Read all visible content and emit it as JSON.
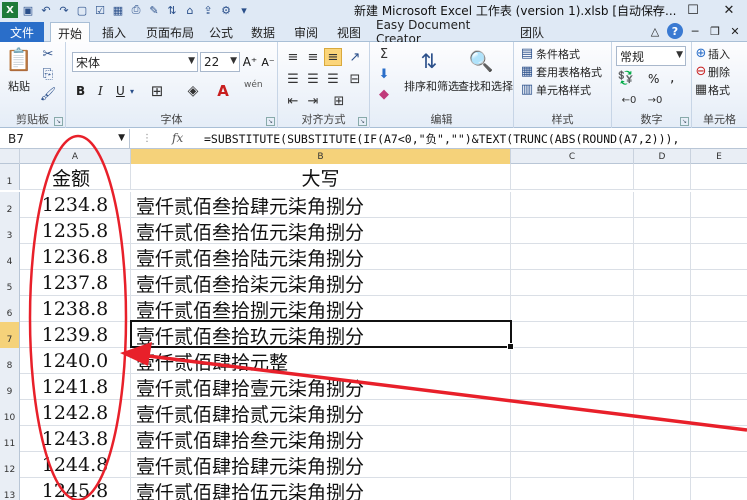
{
  "window": {
    "title": "新建 Microsoft Excel 工作表 (version 1).xlsb [自动保存...",
    "minimize": "─",
    "maximize": "☐",
    "close": "✕"
  },
  "tabs": {
    "file": "文件",
    "home": "开始",
    "insert": "插入",
    "page_layout": "页面布局",
    "formulas": "公式",
    "data": "数据",
    "review": "审阅",
    "view": "视图",
    "easy_doc": "Easy Document Creator",
    "team": "团队"
  },
  "ribbon": {
    "clipboard": {
      "paste": "粘贴",
      "label": "剪贴板"
    },
    "font": {
      "name": "宋体",
      "size": "22",
      "label": "字体",
      "bold": "B",
      "italic": "I",
      "underline": "U",
      "wen": "wén"
    },
    "alignment": {
      "label": "对齐方式"
    },
    "editing": {
      "sort_filter": "排序和筛选",
      "find_select": "查找和选择",
      "label": "编辑"
    },
    "styles": {
      "conditional": "条件格式",
      "table_format": "套用表格格式",
      "cell_styles": "单元格样式",
      "label": "样式"
    },
    "number": {
      "format": "常规",
      "percent": "%",
      "comma": ",",
      "label": "数字"
    },
    "cells": {
      "insert": "插入",
      "delete": "删除",
      "format": "格式",
      "label": "单元格"
    }
  },
  "formula_bar": {
    "name_box": "B7",
    "fx": "fx",
    "formula": "=SUBSTITUTE(SUBSTITUTE(IF(A7<0,\"负\",\"\")&TEXT(TRUNC(ABS(ROUND(A7,2))),"
  },
  "columns": [
    "A",
    "B",
    "C",
    "D",
    "E"
  ],
  "header_row": {
    "row": "1",
    "a": "金额",
    "b": "大写"
  },
  "rows": [
    {
      "row": "2",
      "a": "1234.8",
      "b": "壹仟贰佰叁拾肆元柒角捌分"
    },
    {
      "row": "3",
      "a": "1235.8",
      "b": "壹仟贰佰叁拾伍元柒角捌分"
    },
    {
      "row": "4",
      "a": "1236.8",
      "b": "壹仟贰佰叁拾陆元柒角捌分"
    },
    {
      "row": "5",
      "a": "1237.8",
      "b": "壹仟贰佰叁拾柒元柒角捌分"
    },
    {
      "row": "6",
      "a": "1238.8",
      "b": "壹仟贰佰叁拾捌元柒角捌分"
    },
    {
      "row": "7",
      "a": "1239.8",
      "b": "壹仟贰佰叁拾玖元柒角捌分"
    },
    {
      "row": "8",
      "a": "1240.0",
      "b": "壹仟贰佰肆拾元整"
    },
    {
      "row": "9",
      "a": "1241.8",
      "b": "壹仟贰佰肆拾壹元柒角捌分"
    },
    {
      "row": "10",
      "a": "1242.8",
      "b": "壹仟贰佰肆拾贰元柒角捌分"
    },
    {
      "row": "11",
      "a": "1243.8",
      "b": "壹仟贰佰肆拾叁元柒角捌分"
    },
    {
      "row": "12",
      "a": "1244.8",
      "b": "壹仟贰佰肆拾肆元柒角捌分"
    },
    {
      "row": "13",
      "a": "1245.8",
      "b": "壹仟贰佰肆拾伍元柒角捌分"
    }
  ],
  "annotation_color": "#e8202a"
}
